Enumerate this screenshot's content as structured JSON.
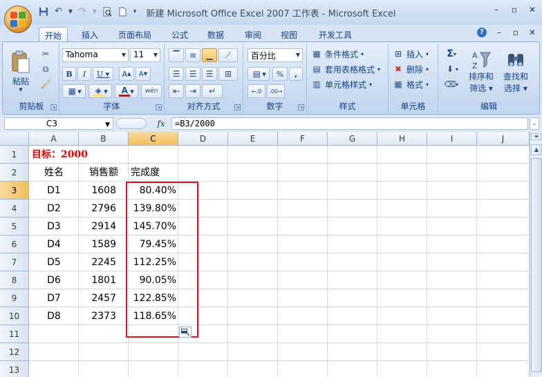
{
  "window": {
    "title": "新建 Microsoft Office Excel 2007 工作表 - Microsoft Excel"
  },
  "tabs": [
    "开始",
    "插入",
    "页面布局",
    "公式",
    "数据",
    "审阅",
    "视图",
    "开发工具"
  ],
  "ribbon": {
    "clipboard": {
      "label": "剪贴板",
      "paste": "粘贴"
    },
    "font": {
      "label": "字体",
      "name": "Tahoma",
      "size": "11"
    },
    "alignment": {
      "label": "对齐方式"
    },
    "number": {
      "label": "数字",
      "format": "百分比"
    },
    "styles": {
      "label": "样式",
      "conditional": "条件格式",
      "table": "套用表格格式",
      "cell": "单元格样式"
    },
    "cells": {
      "label": "单元格",
      "insert": "插入",
      "delete": "删除",
      "format": "格式"
    },
    "editing": {
      "label": "编辑",
      "sort1": "排序和",
      "sort2": "筛选",
      "find1": "查找和",
      "find2": "选择"
    }
  },
  "formula_bar": {
    "name_box": "C3",
    "formula": "=B3/2000"
  },
  "sheet": {
    "columns": [
      "A",
      "B",
      "C",
      "D",
      "E",
      "F",
      "G",
      "H",
      "I",
      "J"
    ],
    "rows": [
      "1",
      "2",
      "3",
      "4",
      "5",
      "6",
      "7",
      "8",
      "9",
      "10",
      "11",
      "12",
      "13"
    ],
    "target": "目标：2000",
    "headers": [
      "姓名",
      "销售额",
      "完成度"
    ],
    "data": [
      [
        "D1",
        "1608",
        "80.40%"
      ],
      [
        "D2",
        "2796",
        "139.80%"
      ],
      [
        "D3",
        "2914",
        "145.70%"
      ],
      [
        "D4",
        "1589",
        "79.45%"
      ],
      [
        "D5",
        "2245",
        "112.25%"
      ],
      [
        "D6",
        "1801",
        "90.05%"
      ],
      [
        "D7",
        "2457",
        "122.85%"
      ],
      [
        "D8",
        "2373",
        "118.65%"
      ]
    ]
  },
  "colors": {
    "target_text": "#e00000",
    "highlight_box": "#e0141e",
    "selected_header": "#f1c15f"
  }
}
